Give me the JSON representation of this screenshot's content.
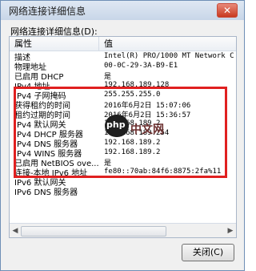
{
  "window": {
    "title": "网络连接详细信息",
    "close_label": "✕"
  },
  "caption": "网络连接详细信息(D):",
  "columns": [
    "属性",
    "值"
  ],
  "rows": [
    {
      "property": "描述",
      "value": "Intel(R) PRO/1000 MT Network C"
    },
    {
      "property": "物理地址",
      "value": "00-0C-29-3A-B9-E1"
    },
    {
      "property": "已启用 DHCP",
      "value": "是"
    },
    {
      "property": "IPv4 地址",
      "value": "192.168.189.128"
    },
    {
      "property": "IPv4 子网掩码",
      "value": "255.255.255.0"
    },
    {
      "property": "获得租约的时间",
      "value": "2016年6月2日 15:07:06"
    },
    {
      "property": "租约过期的时间",
      "value": "2016年6月2日 15:36:57"
    },
    {
      "property": "IPv4 默认网关",
      "value": "192.168.189.2"
    },
    {
      "property": "IPv4 DHCP 服务器",
      "value": "192.168.189.254"
    },
    {
      "property": "IPv4 DNS 服务器",
      "value": "192.168.189.2"
    },
    {
      "property": "IPv4 WINS 服务器",
      "value": "192.168.189.2"
    },
    {
      "property": "已启用 NetBIOS ove...",
      "value": "是"
    },
    {
      "property": "连接-本地 IPv6 地址",
      "value": "fe80::70ab:84f6:8875:2fa%11"
    },
    {
      "property": "IPv6 默认网关",
      "value": ""
    },
    {
      "property": "IPv6 DNS 服务器",
      "value": ""
    }
  ],
  "scroll": {
    "left_arrow": "◀",
    "right_arrow": "▶"
  },
  "close_button": "关闭(C)",
  "watermark": {
    "logo": "php",
    "text": "中文网"
  }
}
